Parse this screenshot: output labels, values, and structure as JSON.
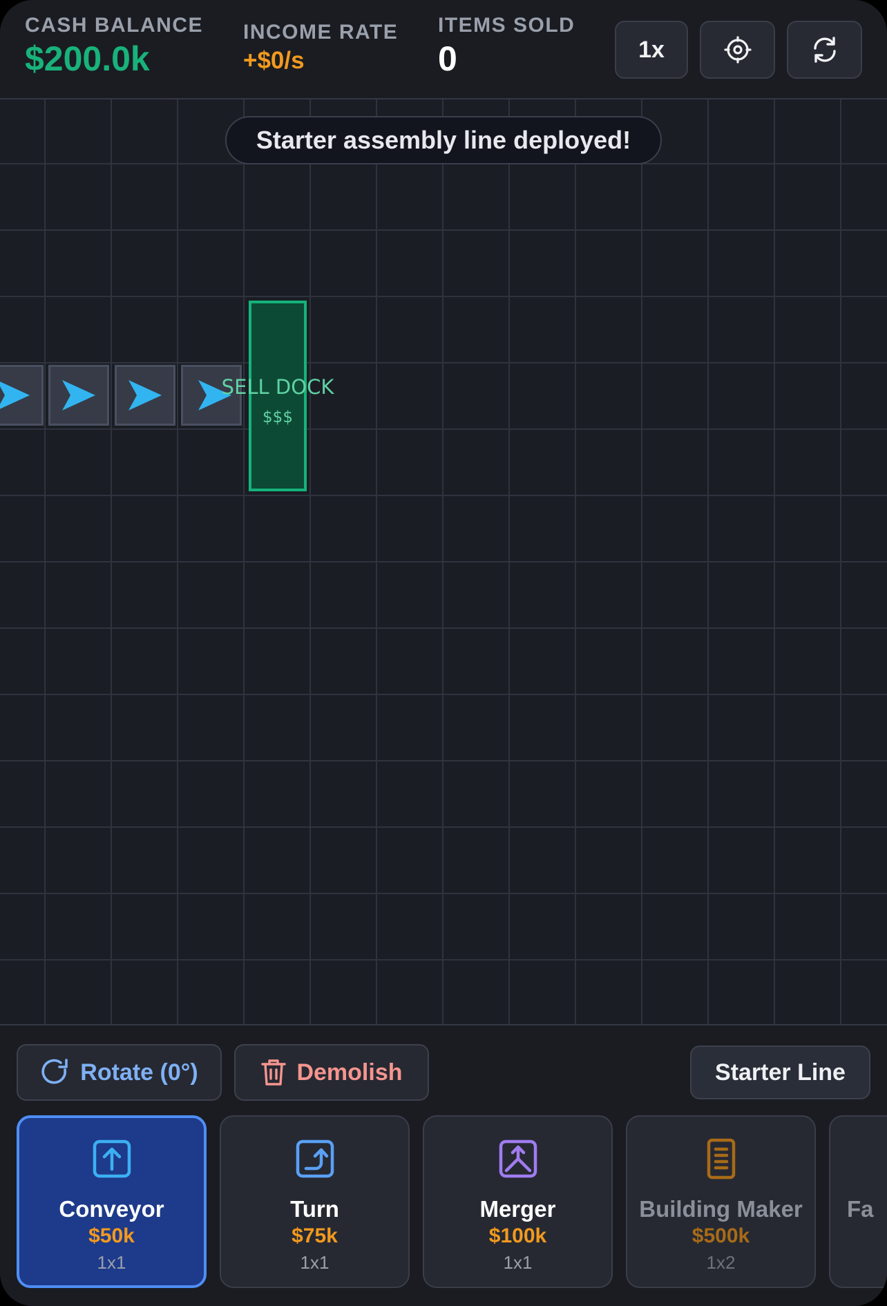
{
  "header": {
    "cash": {
      "label": "CASH BALANCE",
      "value": "$200.0k",
      "color": "#19b27a"
    },
    "income": {
      "label": "INCOME RATE",
      "value": "+$0/s",
      "color": "#f29a1e"
    },
    "items": {
      "label": "ITEMS SOLD",
      "value": "0"
    },
    "buttons": {
      "speed": "1x",
      "center_icon": "target-icon",
      "reset_icon": "refresh-icon"
    }
  },
  "board": {
    "toast": "Starter assembly line deployed!",
    "conveyors": [
      {
        "direction": "right",
        "icon": "arrow-right-icon"
      },
      {
        "direction": "right",
        "icon": "arrow-right-icon"
      },
      {
        "direction": "right",
        "icon": "arrow-right-icon"
      },
      {
        "direction": "right",
        "icon": "arrow-right-icon"
      }
    ],
    "sell_dock": {
      "label": "SELL DOCK",
      "sub": "$$$",
      "color": "#14b37a"
    }
  },
  "tools": {
    "rotate": "Rotate (0°)",
    "demolish": "Demolish",
    "starter": "Starter Line"
  },
  "buildings": [
    {
      "name": "Conveyor",
      "price": "$50k",
      "size": "1x1",
      "icon": "conveyor-icon",
      "selected": true,
      "affordable": true
    },
    {
      "name": "Turn",
      "price": "$75k",
      "size": "1x1",
      "icon": "turn-icon",
      "selected": false,
      "affordable": true
    },
    {
      "name": "Merger",
      "price": "$100k",
      "size": "1x1",
      "icon": "merger-icon",
      "selected": false,
      "affordable": true
    },
    {
      "name": "Building Maker",
      "price": "$500k",
      "size": "1x2",
      "icon": "building-maker-icon",
      "selected": false,
      "affordable": false
    },
    {
      "name": "Fa"
    }
  ]
}
